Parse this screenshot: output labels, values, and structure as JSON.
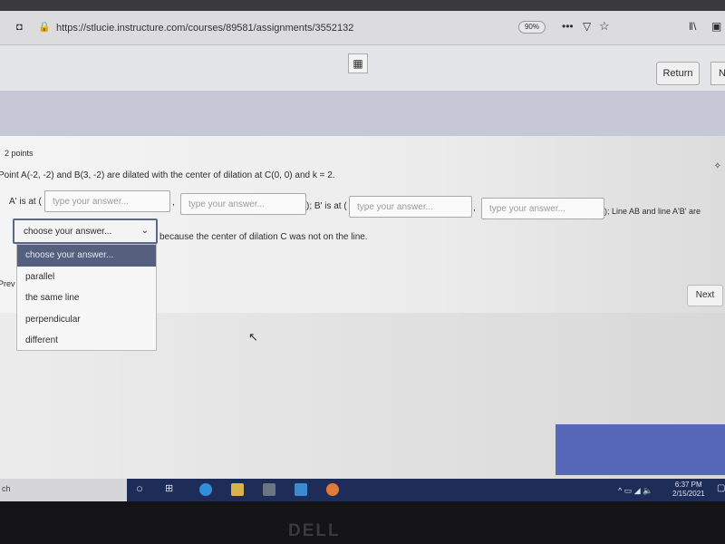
{
  "browser": {
    "url": "https://stlucie.instructure.com/courses/89581/assignments/3552132",
    "zoom": "90%"
  },
  "toolbar": {
    "return_label": "Return",
    "next_partial": "N"
  },
  "question": {
    "points": "2 points",
    "prompt": "Point A(-2, -2) and B(3, -2) are dilated with the center of dilation at C(0, 0) and k = 2.",
    "a_label": "A' is at (",
    "comma": ",",
    "b_label": "); B' is at (",
    "tail": "); Line AB and line A'B' are",
    "placeholder": "type your answer...",
    "after_dropdown": "because the center of dilation C was not on the line.",
    "dropdown": {
      "value": "choose your answer...",
      "options": [
        "choose your answer...",
        "parallel",
        "the same line",
        "perpendicular",
        "different"
      ]
    }
  },
  "nav": {
    "prev_partial": "Prev",
    "next_label": "Next"
  },
  "taskbar": {
    "search_partial": "ch",
    "time": "6:37 PM",
    "date": "2/15/2021"
  },
  "brand": "DELL"
}
